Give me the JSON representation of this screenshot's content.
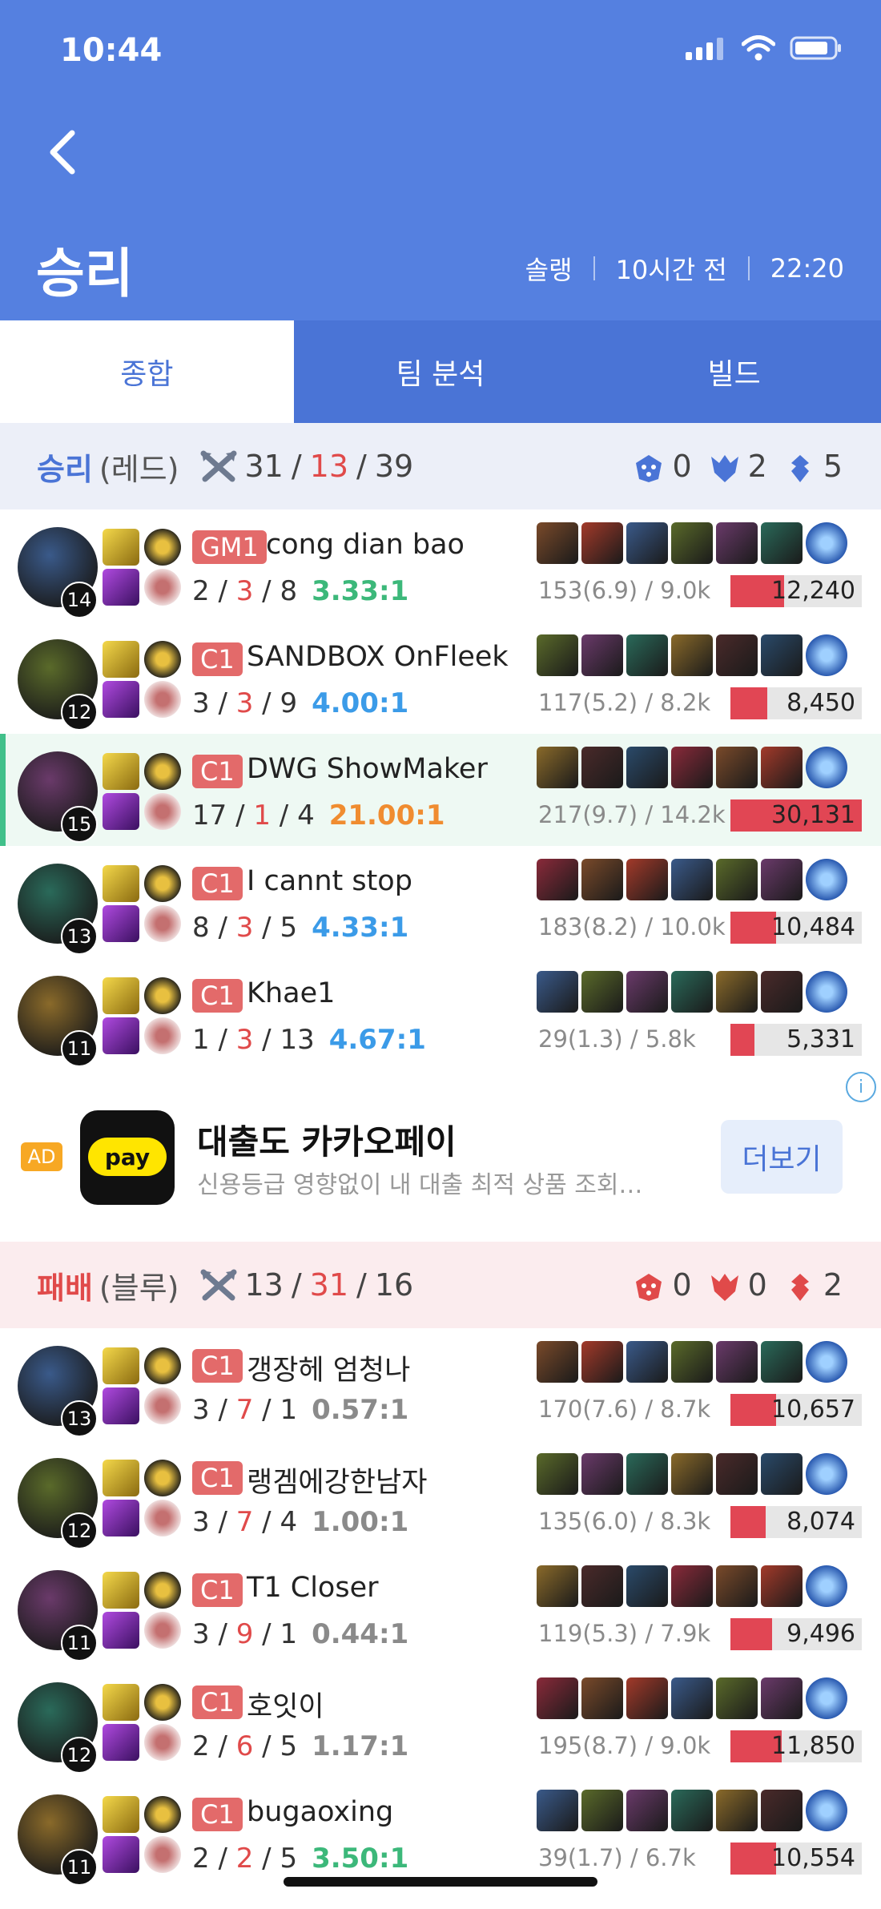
{
  "status": {
    "time": "10:44"
  },
  "header": {
    "title": "승리",
    "queue": "솔랭",
    "ago": "10시간 전",
    "duration": "22:20"
  },
  "tabs": [
    {
      "label": "종합"
    },
    {
      "label": "팀 분석"
    },
    {
      "label": "빌드"
    }
  ],
  "winTeam": {
    "result": "승리",
    "side": "(레드)",
    "kills": "31",
    "deaths": "13",
    "assists": "39",
    "objectives": [
      "0",
      "2",
      "5"
    ],
    "resultColor": "#4a74d6",
    "players": [
      {
        "level": "14",
        "tier": "GM1",
        "name": "cong dian bao",
        "k": "2",
        "d": "3",
        "a": "8",
        "ratio": "3.33:1",
        "ratioColor": "#3cb87a",
        "cs": "153(6.9) / 9.0k",
        "damage": "12,240",
        "damageShare": 0.41
      },
      {
        "level": "12",
        "tier": "C1",
        "name": "SANDBOX OnFleek",
        "k": "3",
        "d": "3",
        "a": "9",
        "ratio": "4.00:1",
        "ratioColor": "#3b9be8",
        "cs": "117(5.2) / 8.2k",
        "damage": "8,450",
        "damageShare": 0.28
      },
      {
        "level": "15",
        "tier": "C1",
        "name": "DWG ShowMaker",
        "k": "17",
        "d": "1",
        "a": "4",
        "ratio": "21.00:1",
        "ratioColor": "#f08c30",
        "cs": "217(9.7) / 14.2k",
        "damage": "30,131",
        "damageShare": 1.0
      },
      {
        "level": "13",
        "tier": "C1",
        "name": "I cannt stop",
        "k": "8",
        "d": "3",
        "a": "5",
        "ratio": "4.33:1",
        "ratioColor": "#3b9be8",
        "cs": "183(8.2) / 10.0k",
        "damage": "10,484",
        "damageShare": 0.35
      },
      {
        "level": "11",
        "tier": "C1",
        "name": "Khae1",
        "k": "1",
        "d": "3",
        "a": "13",
        "ratio": "4.67:1",
        "ratioColor": "#3b9be8",
        "cs": "29(1.3) / 5.8k",
        "damage": "5,331",
        "damageShare": 0.18
      }
    ]
  },
  "ad": {
    "badge": "AD",
    "logo": "pay",
    "title": "대출도 카카오페이",
    "desc": "신용등급 영향없이 내 대출 최적 상품 조회…",
    "button": "더보기",
    "info": "i"
  },
  "loseTeam": {
    "result": "패배",
    "side": "(블루)",
    "kills": "13",
    "deaths": "31",
    "assists": "16",
    "objectives": [
      "0",
      "0",
      "2"
    ],
    "resultColor": "#e04a4a",
    "players": [
      {
        "level": "13",
        "tier": "C1",
        "name": "갱장헤 엄청나",
        "k": "3",
        "d": "7",
        "a": "1",
        "ratio": "0.57:1",
        "ratioColor": "#8a8a8a",
        "cs": "170(7.6) / 8.7k",
        "damage": "10,657",
        "damageShare": 0.35
      },
      {
        "level": "12",
        "tier": "C1",
        "name": "랭겜에강한남자",
        "k": "3",
        "d": "7",
        "a": "4",
        "ratio": "1.00:1",
        "ratioColor": "#8a8a8a",
        "cs": "135(6.0) / 8.3k",
        "damage": "8,074",
        "damageShare": 0.27
      },
      {
        "level": "11",
        "tier": "C1",
        "name": "T1 Closer",
        "k": "3",
        "d": "9",
        "a": "1",
        "ratio": "0.44:1",
        "ratioColor": "#8a8a8a",
        "cs": "119(5.3) / 7.9k",
        "damage": "9,496",
        "damageShare": 0.32
      },
      {
        "level": "12",
        "tier": "C1",
        "name": "호잇이",
        "k": "2",
        "d": "6",
        "a": "5",
        "ratio": "1.17:1",
        "ratioColor": "#8a8a8a",
        "cs": "195(8.7) / 9.0k",
        "damage": "11,850",
        "damageShare": 0.39
      },
      {
        "level": "11",
        "tier": "C1",
        "name": "bugaoxing",
        "k": "2",
        "d": "2",
        "a": "5",
        "ratio": "3.50:1",
        "ratioColor": "#3cb87a",
        "cs": "39(1.7) / 6.7k",
        "damage": "10,554",
        "damageShare": 0.35
      }
    ]
  }
}
